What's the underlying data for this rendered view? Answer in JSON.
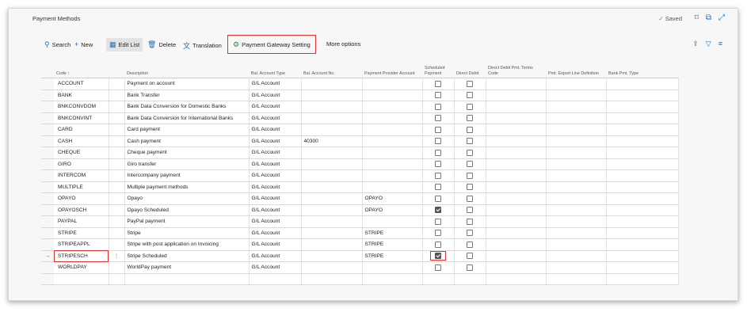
{
  "page": {
    "title": "Payment Methods",
    "saved_label": "Saved"
  },
  "toolbar": {
    "search": "Search",
    "new": "New",
    "edit_list": "Edit List",
    "delete": "Delete",
    "translation": "Translation",
    "gateway": "Payment Gateway Setting",
    "more": "More options"
  },
  "columns": [
    "Code ↑",
    "Description",
    "Bal. Account Type",
    "Bal. Account No.",
    "Payment Provider Account",
    "Scheduled Payment",
    "Direct Debit",
    "Direct Debit Pmt. Terms Code",
    "Pmt. Export Line Definition",
    "Bank Pmt. Type"
  ],
  "rows": [
    {
      "code": "ACCOUNT",
      "desc": "Payment on account",
      "type": "G/L Account",
      "no": "",
      "provider": "",
      "scheduled": false,
      "direct": false
    },
    {
      "code": "BANK",
      "desc": "Bank Transfer",
      "type": "G/L Account",
      "no": "",
      "provider": "",
      "scheduled": false,
      "direct": false
    },
    {
      "code": "BNKCONVDOM",
      "desc": "Bank Data Conversion for Domestic Banks",
      "type": "G/L Account",
      "no": "",
      "provider": "",
      "scheduled": false,
      "direct": false
    },
    {
      "code": "BNKCONVINT",
      "desc": "Bank Data Conversion for International Banks",
      "type": "G/L Account",
      "no": "",
      "provider": "",
      "scheduled": false,
      "direct": false
    },
    {
      "code": "CARD",
      "desc": "Card payment",
      "type": "G/L Account",
      "no": "",
      "provider": "",
      "scheduled": false,
      "direct": false
    },
    {
      "code": "CASH",
      "desc": "Cash payment",
      "type": "G/L Account",
      "no": "40300",
      "provider": "",
      "scheduled": false,
      "direct": false
    },
    {
      "code": "CHEQUE",
      "desc": "Cheque payment",
      "type": "G/L Account",
      "no": "",
      "provider": "",
      "scheduled": false,
      "direct": false
    },
    {
      "code": "GIRO",
      "desc": "Giro transfer",
      "type": "G/L Account",
      "no": "",
      "provider": "",
      "scheduled": false,
      "direct": false
    },
    {
      "code": "INTERCOM",
      "desc": "Intercompany payment",
      "type": "G/L Account",
      "no": "",
      "provider": "",
      "scheduled": false,
      "direct": false
    },
    {
      "code": "MULTIPLE",
      "desc": "Multiple payment methods",
      "type": "G/L Account",
      "no": "",
      "provider": "",
      "scheduled": false,
      "direct": false
    },
    {
      "code": "OPAYO",
      "desc": "Opayo",
      "type": "G/L Account",
      "no": "",
      "provider": "OPAYO",
      "scheduled": false,
      "direct": false
    },
    {
      "code": "OPAYOSCH",
      "desc": "Opayo Scheduled",
      "type": "G/L Account",
      "no": "",
      "provider": "OPAYO",
      "scheduled": true,
      "direct": false
    },
    {
      "code": "PAYPAL",
      "desc": "PayPal payment",
      "type": "G/L Account",
      "no": "",
      "provider": "",
      "scheduled": false,
      "direct": false
    },
    {
      "code": "STRIPE",
      "desc": "Stripe",
      "type": "G/L Account",
      "no": "",
      "provider": "STRIPE",
      "scheduled": false,
      "direct": false
    },
    {
      "code": "STRIPEAPPL",
      "desc": "Stripe with post application on Invoicing",
      "type": "G/L Account",
      "no": "",
      "provider": "STRIPE",
      "scheduled": false,
      "direct": false
    },
    {
      "code": "STRIPESCH",
      "desc": "Stripe Scheduled",
      "type": "G/L Account",
      "no": "",
      "provider": "STRIPE",
      "scheduled": true,
      "direct": false,
      "selected": true
    },
    {
      "code": "WORLDPAY",
      "desc": "WorldPay payment",
      "type": "G/L Account",
      "no": "",
      "provider": "",
      "scheduled": false,
      "direct": false
    }
  ],
  "colors": {
    "accent": "#1f6fb3",
    "highlight": "#dd3333"
  }
}
